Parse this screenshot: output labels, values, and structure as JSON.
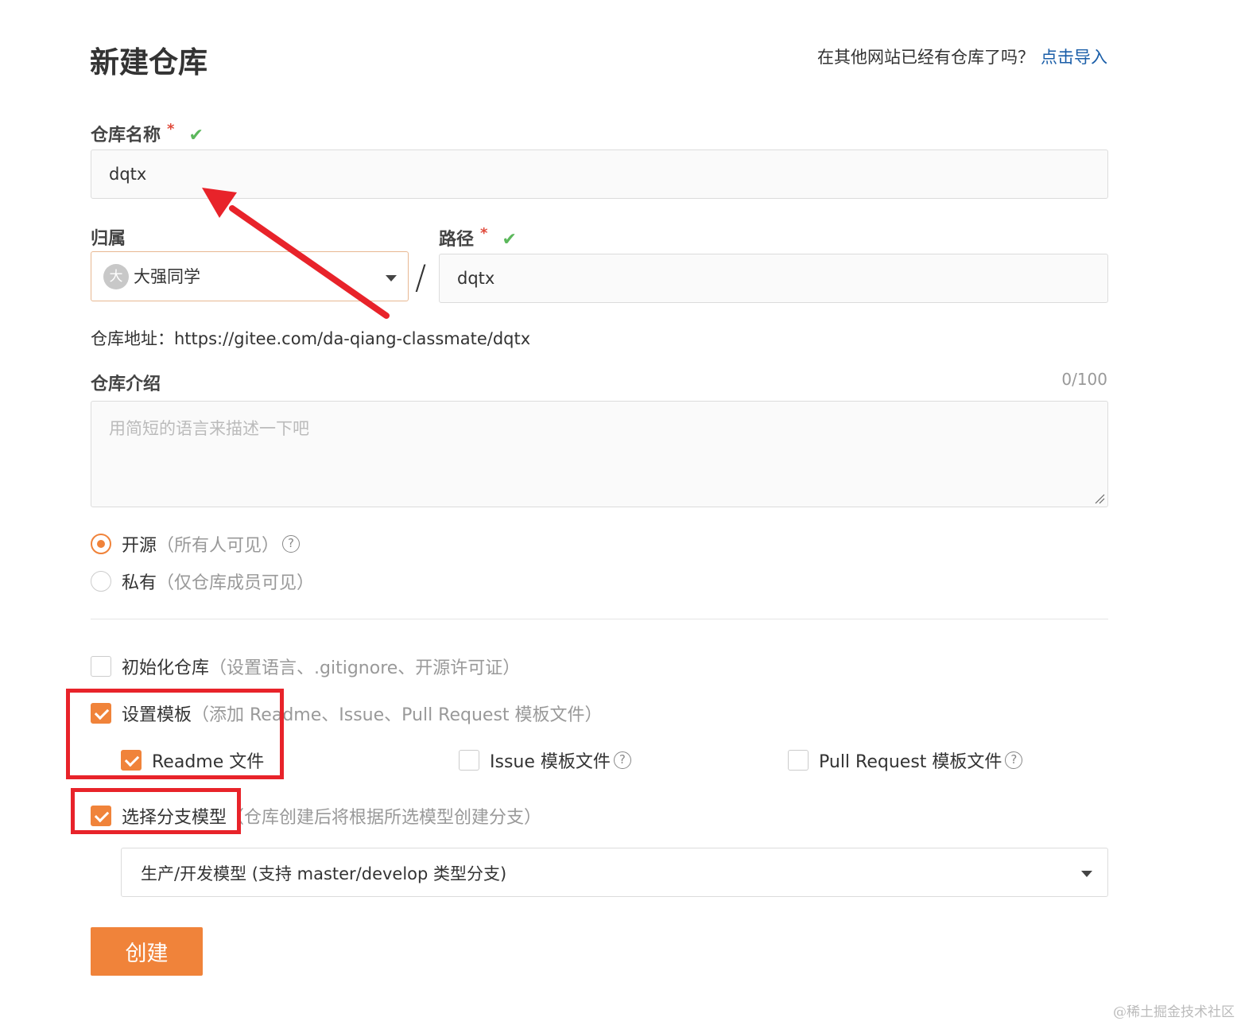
{
  "header": {
    "title": "新建仓库",
    "import_question": "在其他网站已经有仓库了吗？",
    "import_link": "点击导入"
  },
  "repo_name": {
    "label": "仓库名称",
    "required_mark": "*",
    "valid_mark": "✔",
    "value": "dqtx"
  },
  "owner": {
    "label": "归属",
    "avatar_char": "大",
    "value": "大强同学"
  },
  "path": {
    "label": "路径",
    "required_mark": "*",
    "valid_mark": "✔",
    "separator": "/",
    "value": "dqtx"
  },
  "repo_address": "仓库地址：https://gitee.com/da-qiang-classmate/dqtx",
  "description": {
    "label": "仓库介绍",
    "counter": "0/100",
    "placeholder": "用简短的语言来描述一下吧"
  },
  "visibility": {
    "public_label": "开源",
    "public_hint": "（所有人可见）",
    "private_label": "私有",
    "private_hint": "（仅仓库成员可见）",
    "selected": "public",
    "help_glyph": "?"
  },
  "options": {
    "init_label": "初始化仓库",
    "init_hint": "（设置语言、.gitignore、开源许可证）",
    "init_checked": false,
    "template_label": "设置模板",
    "template_hint": "（添加 Readme、Issue、Pull Request 模板文件）",
    "template_checked": true,
    "readme_label": "Readme 文件",
    "readme_checked": true,
    "issue_label": "Issue 模板文件",
    "issue_checked": false,
    "pr_label": "Pull Request 模板文件",
    "pr_checked": false,
    "branch_label": "选择分支模型",
    "branch_hint": "（仓库创建后将根据所选模型创建分支）",
    "branch_checked": true,
    "branch_model": "生产/开发模型 (支持 master/develop 类型分支)"
  },
  "submit_label": "创建",
  "watermark": "@稀土掘金技术社区",
  "colors": {
    "accent": "#f0833a",
    "link": "#1a5ea8",
    "annotation_red": "#e8232a",
    "valid_green": "#5cb85c"
  }
}
